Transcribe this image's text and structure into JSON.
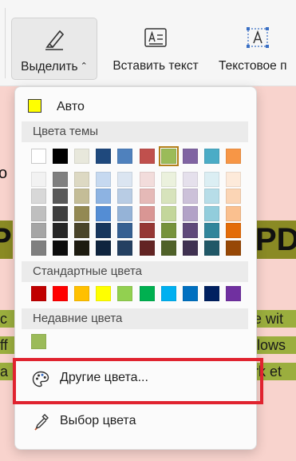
{
  "ribbon": {
    "highlight_label": "Выделить",
    "highlight_caret": "⌃",
    "insert_text_label": "Вставить текст",
    "text_box_label": "Текстовое п",
    "icons": [
      "highlighter-icon",
      "insert-text-icon",
      "text-box-icon"
    ]
  },
  "document": {
    "fragment_o": "o",
    "fragment_big_left": "P",
    "fragment_big_right": "PD",
    "line1_left": "c",
    "line1_right": "e wit",
    "line2_left": "ff",
    "line2_right": "llows",
    "line3_left": "a",
    "line3_right": "rk et"
  },
  "menu": {
    "auto_label": "Авто",
    "auto_color": "#ffff00",
    "theme_heading": "Цвета темы",
    "standard_heading": "Стандартные цвета",
    "recent_heading": "Недавние цвета",
    "more_colors_label": "Другие цвета...",
    "pick_color_label": "Выбор цвета",
    "theme_top_row": [
      "#ffffff",
      "#000000",
      "#e8e8dc",
      "#1f497d",
      "#4f81bd",
      "#c0504d",
      "#9bbb59",
      "#8064a2",
      "#4bacc6",
      "#f79646"
    ],
    "theme_selected_index": 6,
    "theme_shades": [
      [
        "#f2f2f2",
        "#7f7f7f",
        "#ddd9c3",
        "#c6d9f0",
        "#dbe5f1",
        "#f2dcdb",
        "#ebf1dd",
        "#e5e0ec",
        "#dbeef3",
        "#fdeada"
      ],
      [
        "#d8d8d8",
        "#595959",
        "#c4bd97",
        "#8db3e2",
        "#b8cce4",
        "#e5b9b7",
        "#d7e3bc",
        "#ccc1d9",
        "#b7dde8",
        "#fbd5b5"
      ],
      [
        "#bfbfbf",
        "#3f3f3f",
        "#938953",
        "#548dd4",
        "#95b3d7",
        "#d99694",
        "#c3d69b",
        "#b2a2c7",
        "#92cddc",
        "#fac08f"
      ],
      [
        "#a5a5a5",
        "#262626",
        "#494429",
        "#17365d",
        "#366092",
        "#953734",
        "#76923c",
        "#5f497a",
        "#31859b",
        "#e36c09"
      ],
      [
        "#7f7f7f",
        "#0c0c0c",
        "#1d1b10",
        "#0f243e",
        "#244061",
        "#632423",
        "#4f6128",
        "#3f3151",
        "#205867",
        "#974806"
      ]
    ],
    "standard_colors": [
      "#c00000",
      "#ff0000",
      "#ffc000",
      "#ffff00",
      "#92d050",
      "#00b050",
      "#00b0f0",
      "#0070c0",
      "#002060",
      "#7030a0"
    ],
    "recent_colors": [
      "#9bbb59"
    ],
    "icons": [
      "palette-icon",
      "eyedropper-icon"
    ]
  }
}
